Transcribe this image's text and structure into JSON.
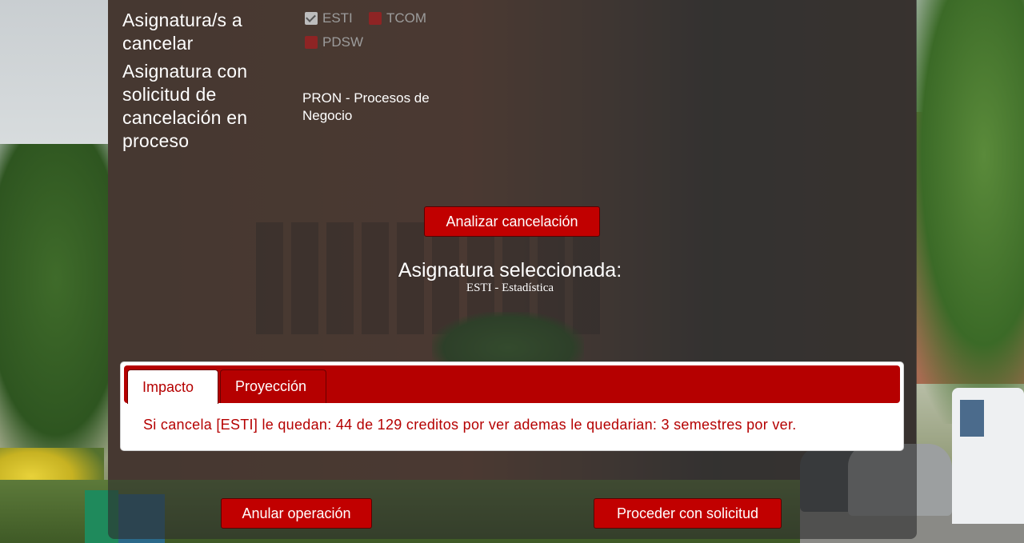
{
  "form": {
    "cancel_label": "Asignatura/s a cancelar",
    "pending_label": "Asignatura con solicitud de cancelación en proceso",
    "pending_value": "PRON - Procesos de Negocio"
  },
  "subjects": [
    {
      "code": "ESTI",
      "checked": true
    },
    {
      "code": "TCOM",
      "checked": false
    },
    {
      "code": "PDSW",
      "checked": false
    }
  ],
  "buttons": {
    "analyze": "Analizar cancelación",
    "cancel_operation": "Anular operación",
    "proceed": "Proceder con solicitud"
  },
  "selection": {
    "title": "Asignatura seleccionada:",
    "value": "ESTI - Estadística"
  },
  "tabs": {
    "items": [
      "Impacto",
      "Proyección"
    ],
    "active": "Impacto",
    "impact_message": "Si cancela [ESTI] le quedan: 44 de 129 creditos por ver ademas le quedarian: 3 semestres por ver."
  },
  "colors": {
    "accent": "#c10000",
    "tab_bar": "#b50000",
    "panel": "rgba(45,45,45,0.62)"
  }
}
